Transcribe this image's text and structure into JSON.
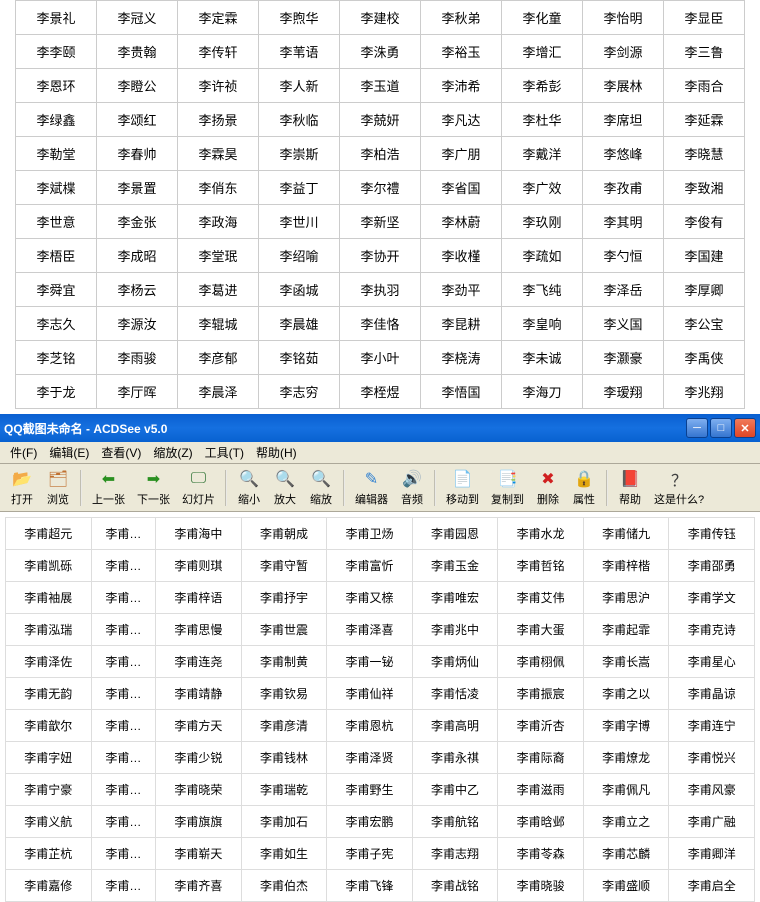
{
  "topTable": [
    [
      "李景礼",
      "李冠义",
      "李定霖",
      "李煦华",
      "李建校",
      "李秋弟",
      "李化童",
      "李怡明",
      "李显臣"
    ],
    [
      "李李颐",
      "李贵翰",
      "李传轩",
      "李苇语",
      "李洙勇",
      "李裕玉",
      "李增汇",
      "李剑源",
      "李三鲁"
    ],
    [
      "李恩环",
      "李瞪公",
      "李许祯",
      "李人新",
      "李玉道",
      "李沛希",
      "李希彭",
      "李展林",
      "李雨合"
    ],
    [
      "李绿鑫",
      "李颂红",
      "李扬景",
      "李秋临",
      "李兢妍",
      "李凡达",
      "李杜华",
      "李席坦",
      "李延霖"
    ],
    [
      "李勒堂",
      "李春帅",
      "李霖昊",
      "李崇斯",
      "李柏浩",
      "李广朋",
      "李戴洋",
      "李悠峰",
      "李晓慧"
    ],
    [
      "李斌楪",
      "李景置",
      "李俏东",
      "李益丁",
      "李尔禮",
      "李省国",
      "李广效",
      "李孜甫",
      "李致湘"
    ],
    [
      "李世意",
      "李金张",
      "李政海",
      "李世川",
      "李新坚",
      "李林蔚",
      "李玖刚",
      "李其明",
      "李俊有"
    ],
    [
      "李梧臣",
      "李成昭",
      "李堂珉",
      "李绍喻",
      "李协开",
      "李收槿",
      "李疏如",
      "李勺恒",
      "李国建"
    ],
    [
      "李舜宜",
      "李杨云",
      "李葛进",
      "李函城",
      "李执羽",
      "李劲平",
      "李飞纯",
      "李泽岳",
      "李厚卿"
    ],
    [
      "李志久",
      "李源汝",
      "李辊城",
      "李晨雄",
      "李佳恪",
      "李昆耕",
      "李皇响",
      "李义国",
      "李公宝"
    ],
    [
      "李芝铭",
      "李雨骏",
      "李彦郁",
      "李铭茹",
      "李小叶",
      "李桡涛",
      "李未诚",
      "李灏豪",
      "李禹侠"
    ],
    [
      "李于龙",
      "李厅晖",
      "李晨泽",
      "李志穷",
      "李桎煜",
      "李悟国",
      "李海刀",
      "李瑷翔",
      "李兆翔"
    ]
  ],
  "window": {
    "title": "QQ截图未命名 - ACDSee v5.0"
  },
  "menus": [
    {
      "label": "件(F)",
      "key": "F"
    },
    {
      "label": "编辑(E)",
      "key": "E"
    },
    {
      "label": "查看(V)",
      "key": "V"
    },
    {
      "label": "缩放(Z)",
      "key": "Z"
    },
    {
      "label": "工具(T)",
      "key": "T"
    },
    {
      "label": "帮助(H)",
      "key": "H"
    }
  ],
  "tools": [
    {
      "label": "打开",
      "icon": "📂",
      "cls": "ico-open"
    },
    {
      "label": "浏览",
      "icon": "🗂",
      "cls": "ico-browse"
    },
    {
      "sep": true
    },
    {
      "label": "上一张",
      "icon": "⬅",
      "cls": "ico-prev"
    },
    {
      "label": "下一张",
      "icon": "➡",
      "cls": "ico-next"
    },
    {
      "label": "幻灯片",
      "icon": "🖵",
      "cls": "ico-slide"
    },
    {
      "sep": true
    },
    {
      "label": "缩小",
      "icon": "🔍",
      "cls": "ico-zoomout"
    },
    {
      "label": "放大",
      "icon": "🔍",
      "cls": "ico-zoomin"
    },
    {
      "label": "缩放",
      "icon": "🔍",
      "cls": "ico-zoom"
    },
    {
      "sep": true
    },
    {
      "label": "编辑器",
      "icon": "✎",
      "cls": "ico-edit"
    },
    {
      "label": "音频",
      "icon": "🔊",
      "cls": "ico-audio"
    },
    {
      "sep": true
    },
    {
      "label": "移动到",
      "icon": "📄",
      "cls": "ico-move"
    },
    {
      "label": "复制到",
      "icon": "📑",
      "cls": "ico-copy"
    },
    {
      "label": "删除",
      "icon": "✖",
      "cls": "ico-del"
    },
    {
      "label": "属性",
      "icon": "🔒",
      "cls": "ico-prop"
    },
    {
      "sep": true
    },
    {
      "label": "帮助",
      "icon": "📕",
      "cls": "ico-help"
    },
    {
      "label": "这是什么?",
      "icon": "？",
      "cls": "ico-what"
    }
  ],
  "bottomTable": [
    [
      "李甫超元",
      "李甫…",
      "李甫海中",
      "李甫朝成",
      "李甫卫炀",
      "李甫园恩",
      "李甫水龙",
      "李甫储九",
      "李甫传钰"
    ],
    [
      "李甫凯砾",
      "李甫…",
      "李甫则琪",
      "李甫守暂",
      "李甫富忻",
      "李甫玉金",
      "李甫哲铭",
      "李甫梓楷",
      "李甫邵勇"
    ],
    [
      "李甫袖展",
      "李甫…",
      "李甫梓语",
      "李甫抒宇",
      "李甫又榇",
      "李甫唯宏",
      "李甫艾伟",
      "李甫思沪",
      "李甫学文"
    ],
    [
      "李甫泓瑞",
      "李甫…",
      "李甫思慢",
      "李甫世震",
      "李甫泽喜",
      "李甫兆中",
      "李甫大蛋",
      "李甫起霏",
      "李甫克诗"
    ],
    [
      "李甫泽佐",
      "李甫…",
      "李甫连尧",
      "李甫制黄",
      "李甫一铋",
      "李甫炳仙",
      "李甫栩佩",
      "李甫长嵩",
      "李甫星心"
    ],
    [
      "李甫无韵",
      "李甫…",
      "李甫靖静",
      "李甫钦易",
      "李甫仙祥",
      "李甫恬凌",
      "李甫振宸",
      "李甫之以",
      "李甫晶谅"
    ],
    [
      "李甫歆尔",
      "李甫…",
      "李甫方天",
      "李甫彦清",
      "李甫恩杭",
      "李甫高明",
      "李甫沂杏",
      "李甫字博",
      "李甫连宁"
    ],
    [
      "李甫字妞",
      "李甫…",
      "李甫少锐",
      "李甫钱林",
      "李甫泽贤",
      "李甫永祺",
      "李甫际裔",
      "李甫燎龙",
      "李甫悦兴"
    ],
    [
      "李甫宁豪",
      "李甫…",
      "李甫晓荣",
      "李甫瑞乾",
      "李甫野生",
      "李甫中乙",
      "李甫滋雨",
      "李甫佩凡",
      "李甫风豪"
    ],
    [
      "李甫义航",
      "李甫…",
      "李甫旗旗",
      "李甫加石",
      "李甫宏鹏",
      "李甫航铭",
      "李甫晗邺",
      "李甫立之",
      "李甫广融"
    ],
    [
      "李甫芷杭",
      "李甫…",
      "李甫崭天",
      "李甫如生",
      "李甫子宪",
      "李甫志翔",
      "李甫苓森",
      "李甫芯麟",
      "李甫卿洋"
    ],
    [
      "李甫嘉修",
      "李甫…",
      "李甫齐喜",
      "李甫伯杰",
      "李甫飞锋",
      "李甫战铭",
      "李甫晓骏",
      "李甫盛顺",
      "李甫启全"
    ]
  ]
}
